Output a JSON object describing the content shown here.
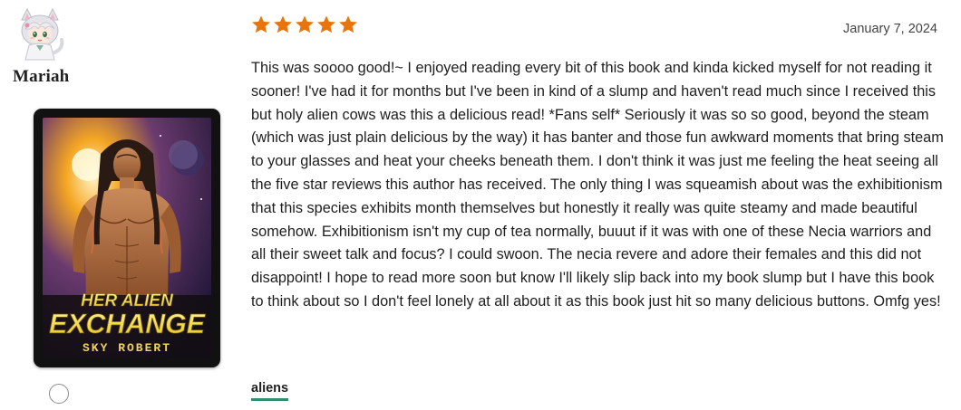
{
  "reviewer": {
    "name": "Mariah",
    "avatar_icon": "anime-cat-girl-avatar-icon"
  },
  "book": {
    "cover_title_line1": "HER ALIEN",
    "cover_title_line2": "EXCHANGE",
    "cover_author": "SKY ROBERT"
  },
  "review": {
    "rating": 5,
    "rating_max": 5,
    "star_color": "#e8740c",
    "date": "January 7, 2024",
    "text": "This was soooo good!~ I enjoyed reading every bit of this book and kinda kicked myself for not reading it sooner! I've had it for months but I've been in kind of a slump and haven't read much since I received this but holy alien cows was this a delicious read! *Fans self* Seriously it was so so good, beyond the steam (which was just plain delicious by the way) it has banter and those fun awkward moments that bring steam to your glasses and heat your cheeks beneath them. I don't think it was just me feeling the heat seeing all the five star reviews this author has received. The only thing I was squeamish about was the exhibitionism that this species exhibits month themselves but honestly it really was quite steamy and made beautiful somehow. Exhibitionism isn't my cup of tea normally, buuut if it was with one of these Necia warriors and all their sweet talk and focus? I could swoon. The necia revere and adore their females and this did not disappoint! I hope to read more soon but know I'll likely slip back into my book slump but I have this book to think about so I don't feel lonely at all about it as this book just hit so many delicious buttons. Omfg yes!",
    "tags": [
      "aliens"
    ],
    "tag_underline_color": "#2f8f6f"
  }
}
